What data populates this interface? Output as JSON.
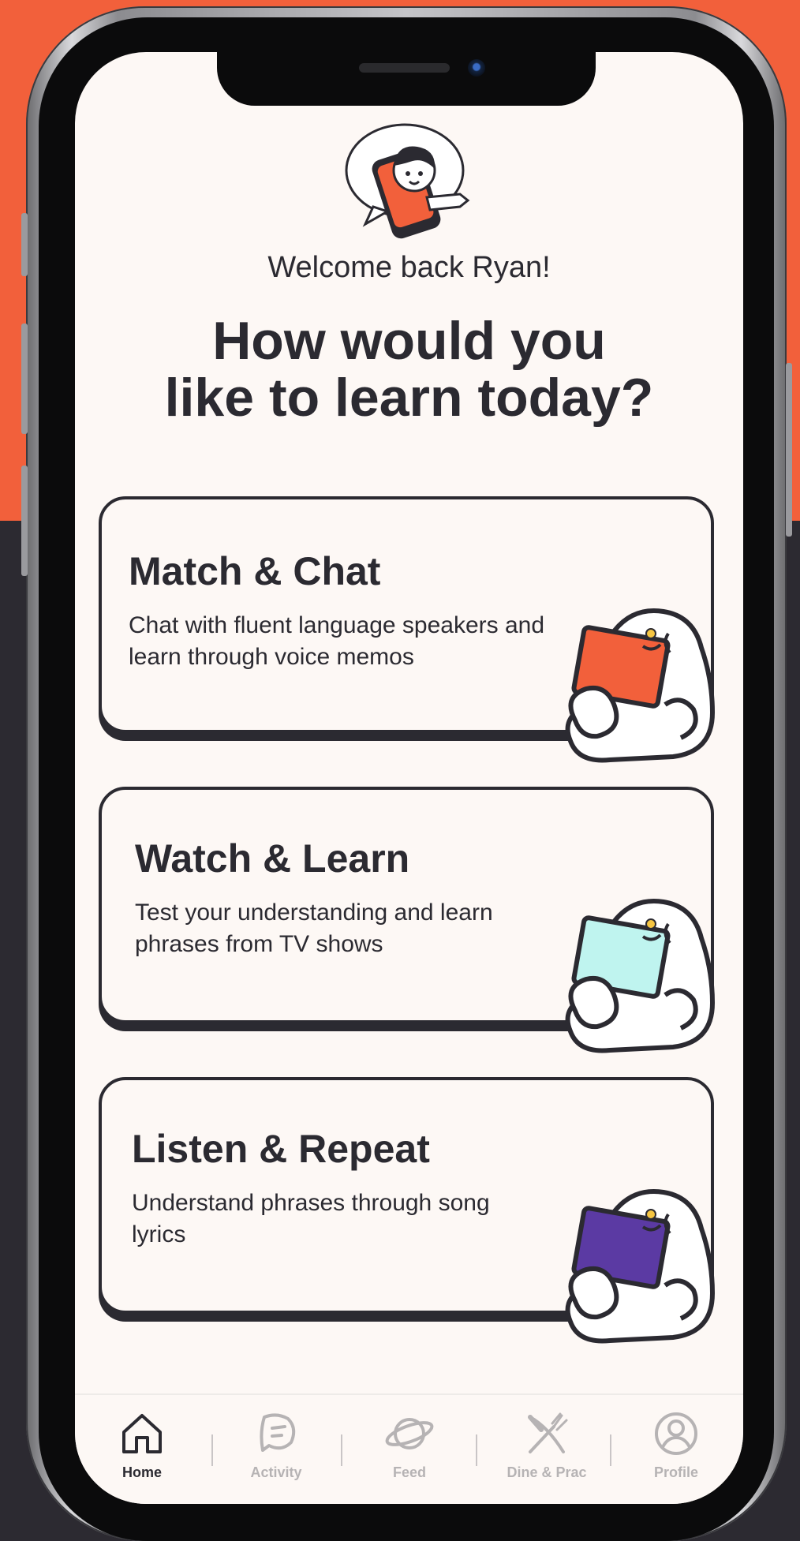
{
  "greeting": "Welcome back Ryan!",
  "headline": {
    "line1": "How would you",
    "line2": "like to learn today?"
  },
  "cards": [
    {
      "title": "Match & Chat",
      "description": "Chat with fluent language speakers and learn through voice memos",
      "accent": "#f2603b"
    },
    {
      "title": "Watch & Learn",
      "description": "Test your understanding and learn phrases from TV shows",
      "accent": "#bff4ef"
    },
    {
      "title": "Listen & Repeat",
      "description": "Understand phrases through song lyrics",
      "accent": "#5b3aa3"
    }
  ],
  "tabbar": {
    "items": [
      {
        "label": "Home",
        "icon": "home-icon",
        "active": true
      },
      {
        "label": "Activity",
        "icon": "activity-icon",
        "active": false
      },
      {
        "label": "Feed",
        "icon": "planet-icon",
        "active": false
      },
      {
        "label": "Dine & Prac",
        "icon": "utensils-icon",
        "active": false
      },
      {
        "label": "Profile",
        "icon": "profile-icon",
        "active": false
      }
    ]
  },
  "colors": {
    "brand": "#f2603b",
    "ink": "#2b2a31",
    "background": "#fdf8f5"
  }
}
